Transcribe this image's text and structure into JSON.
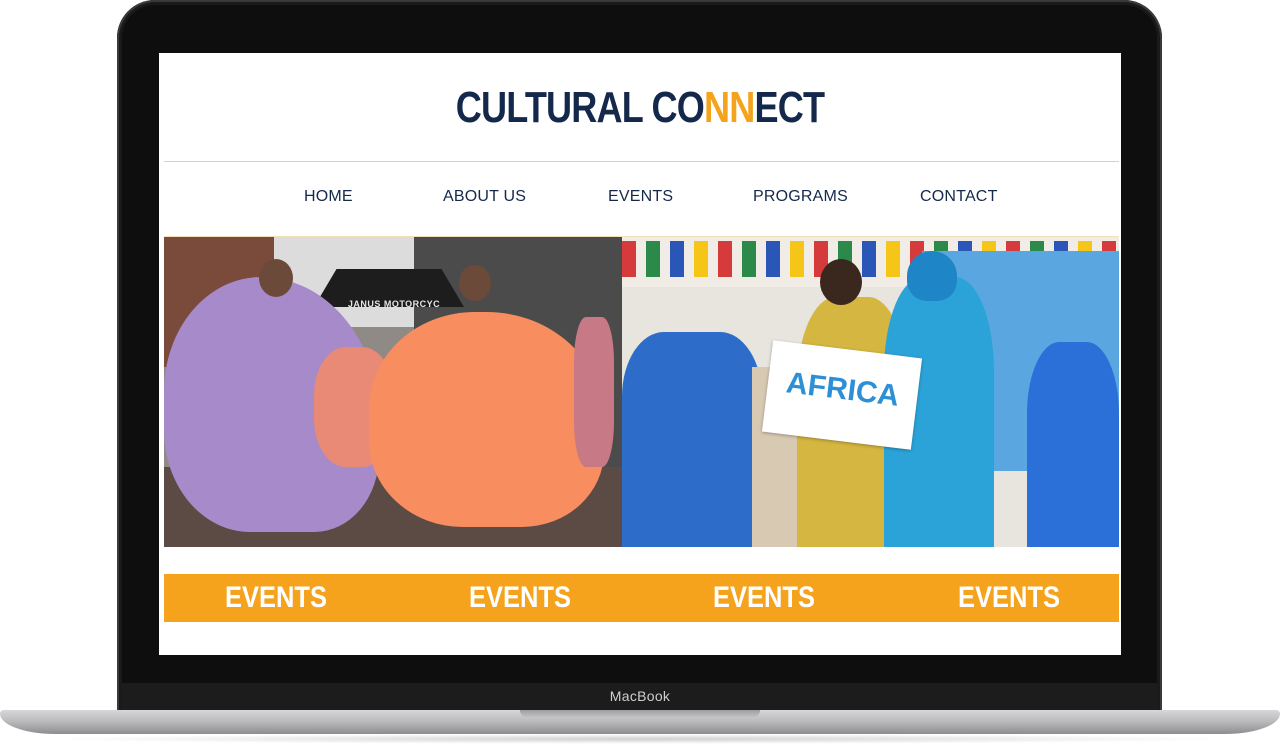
{
  "device": {
    "brand_label": "MacBook"
  },
  "site": {
    "logo": {
      "part1": "CULTURAL CO",
      "accent": "NN",
      "part2": "ECT"
    },
    "nav": [
      {
        "label": "HOME"
      },
      {
        "label": "ABOUT US"
      },
      {
        "label": "EVENTS"
      },
      {
        "label": "PROGRAMS"
      },
      {
        "label": "CONTACT"
      }
    ],
    "hero": {
      "left_photo": {
        "sign_text": "JANUS MOTORCYC"
      },
      "right_photo": {
        "sign_text": "AFRICA"
      }
    },
    "events_strip": [
      {
        "label": "EVENTS"
      },
      {
        "label": "EVENTS"
      },
      {
        "label": "EVENTS"
      },
      {
        "label": "EVENTS"
      }
    ]
  },
  "colors": {
    "navy": "#14284b",
    "orange": "#f5a31c",
    "white": "#ffffff"
  }
}
